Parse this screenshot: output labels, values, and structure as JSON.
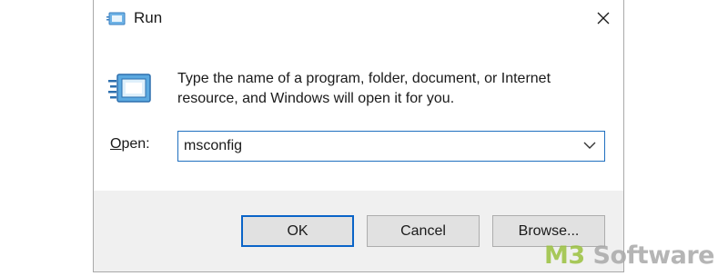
{
  "window": {
    "title": "Run",
    "icon": "run-icon",
    "close_icon": "close-icon"
  },
  "content": {
    "description": "Type the name of a program, folder, document, or Internet resource, and Windows will open it for you.",
    "open_label_mnemonic": "O",
    "open_label_rest": "pen:",
    "open_value": "msconfig",
    "dropdown_icon": "chevron-down-icon"
  },
  "buttons": {
    "ok": "OK",
    "cancel": "Cancel",
    "browse": "Browse..."
  },
  "watermark": {
    "brand_start": "M3",
    "brand_rest": " Software"
  },
  "colors": {
    "focus_border": "#1f6fbf",
    "footer_bg": "#f0f0f0",
    "button_bg": "#e1e1e1",
    "watermark_green": "#9bc23f"
  }
}
